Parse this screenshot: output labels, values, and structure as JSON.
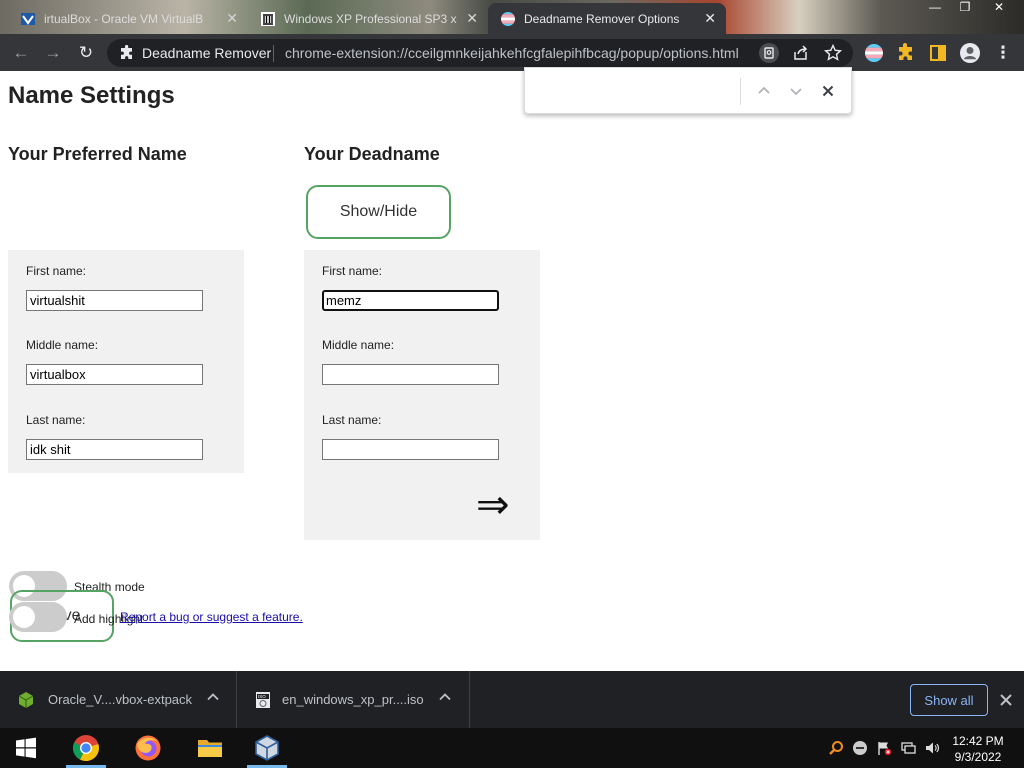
{
  "browser": {
    "tabs": [
      {
        "title": "irtualBox - Oracle VM VirtualB",
        "active": false
      },
      {
        "title": "Windows XP Professional SP3 x",
        "active": false
      },
      {
        "title": "Deadname Remover Options",
        "active": true
      }
    ],
    "omnibox": {
      "extension_name": "Deadname Remover",
      "url": "chrome-extension://cceilgmnkeijahkehfcgfalepihfbcag/popup/options.html"
    }
  },
  "findbar": {
    "query": ""
  },
  "page": {
    "title": "Name Settings",
    "preferred": {
      "heading": "Your Preferred Name",
      "first_label": "First name:",
      "first_value": "virtualshit",
      "middle_label": "Middle name:",
      "middle_value": "virtualbox",
      "last_label": "Last name:",
      "last_value": "idk shit"
    },
    "deadname": {
      "heading": "Your Deadname",
      "show_hide_label": "Show/Hide",
      "first_label": "First name:",
      "first_value": "memz",
      "middle_label": "Middle name:",
      "middle_value": "",
      "last_label": "Last name:",
      "last_value": "",
      "add_arrow": "⇒"
    },
    "options": {
      "stealth_label": "Stealth mode",
      "stealth_on": false,
      "highlight_label": "Add highlight",
      "highlight_on": false
    },
    "save_label": "Save",
    "report_link": "Report a bug or suggest a feature."
  },
  "downloads": {
    "items": [
      {
        "name": "Oracle_V....vbox-extpack"
      },
      {
        "name": "en_windows_xp_pr....iso"
      }
    ],
    "show_all_label": "Show all"
  },
  "taskbar": {
    "apps": [
      "start",
      "chrome",
      "firefox",
      "file-explorer",
      "virtualbox"
    ],
    "clock_time": "12:42 PM",
    "clock_date": "9/3/2022"
  }
}
